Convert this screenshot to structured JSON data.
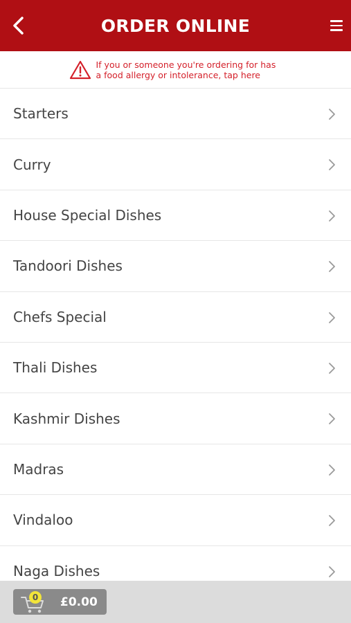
{
  "header": {
    "title": "ORDER ONLINE"
  },
  "allergy_notice": {
    "text": "If you or someone you're ordering for has a food allergy or intolerance, tap here"
  },
  "menu_categories": [
    {
      "label": "Starters"
    },
    {
      "label": "Curry"
    },
    {
      "label": "House Special Dishes"
    },
    {
      "label": "Tandoori Dishes"
    },
    {
      "label": "Chefs Special"
    },
    {
      "label": "Thali Dishes"
    },
    {
      "label": "Kashmir Dishes"
    },
    {
      "label": "Madras"
    },
    {
      "label": "Vindaloo"
    },
    {
      "label": "Naga Dishes"
    }
  ],
  "cart": {
    "count": "0",
    "total": "£0.00"
  },
  "colors": {
    "brand_red": "#b00f14",
    "warning_red": "#d4202a",
    "badge_yellow": "#f2e43a"
  },
  "icons": {
    "back": "chevron-left-icon",
    "menu": "hamburger-icon",
    "warning": "warning-triangle-icon",
    "row": "chevron-right-icon",
    "cart": "shopping-cart-icon"
  }
}
